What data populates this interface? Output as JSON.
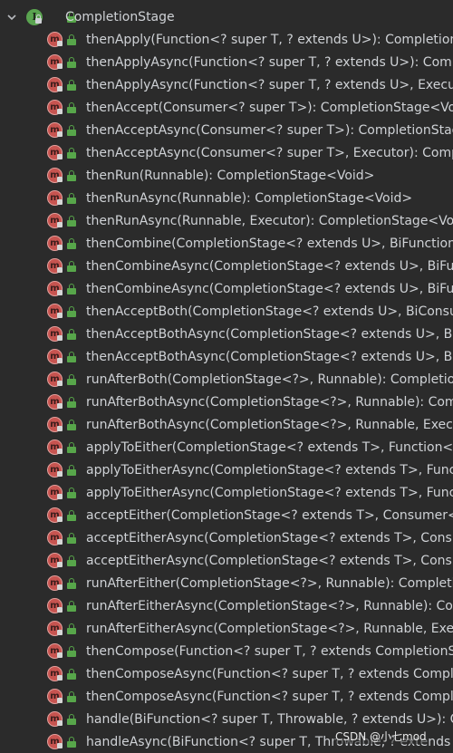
{
  "tree": {
    "interface": {
      "name": "CompletionStage",
      "icon": "interface-icon",
      "expanded": true
    },
    "methods": [
      "thenApply(Function<? super T, ? extends U>): CompletionStage<U>",
      "thenApplyAsync(Function<? super T, ? extends U>): CompletionStage<U>",
      "thenApplyAsync(Function<? super T, ? extends U>, Executor): CompletionStage<U>",
      "thenAccept(Consumer<? super T>): CompletionStage<Void>",
      "thenAcceptAsync(Consumer<? super T>): CompletionStage<Void>",
      "thenAcceptAsync(Consumer<? super T>, Executor): CompletionStage<Void>",
      "thenRun(Runnable): CompletionStage<Void>",
      "thenRunAsync(Runnable): CompletionStage<Void>",
      "thenRunAsync(Runnable, Executor): CompletionStage<Void>",
      "thenCombine(CompletionStage<? extends U>, BiFunction<? super T, ? super U, ? extends V>): CompletionStage<V>",
      "thenCombineAsync(CompletionStage<? extends U>, BiFunction<? super T, ? super U, ? extends V>): CompletionStage<V>",
      "thenCombineAsync(CompletionStage<? extends U>, BiFunction<? super T, ? super U, ? extends V>, Executor): CompletionStage<V>",
      "thenAcceptBoth(CompletionStage<? extends U>, BiConsumer<? super T, ? super U>): CompletionStage<Void>",
      "thenAcceptBothAsync(CompletionStage<? extends U>, BiConsumer<? super T, ? super U>): CompletionStage<Void>",
      "thenAcceptBothAsync(CompletionStage<? extends U>, BiConsumer<? super T, ? super U>, Executor): CompletionStage<Void>",
      "runAfterBoth(CompletionStage<?>, Runnable): CompletionStage<Void>",
      "runAfterBothAsync(CompletionStage<?>, Runnable): CompletionStage<Void>",
      "runAfterBothAsync(CompletionStage<?>, Runnable, Executor): CompletionStage<Void>",
      "applyToEither(CompletionStage<? extends T>, Function<? super T, U>): CompletionStage<U>",
      "applyToEitherAsync(CompletionStage<? extends T>, Function<? super T, U>): CompletionStage<U>",
      "applyToEitherAsync(CompletionStage<? extends T>, Function<? super T, U>, Executor): CompletionStage<U>",
      "acceptEither(CompletionStage<? extends T>, Consumer<? super T>): CompletionStage<Void>",
      "acceptEitherAsync(CompletionStage<? extends T>, Consumer<? super T>): CompletionStage<Void>",
      "acceptEitherAsync(CompletionStage<? extends T>, Consumer<? super T>, Executor): CompletionStage<Void>",
      "runAfterEither(CompletionStage<?>, Runnable): CompletionStage<Void>",
      "runAfterEitherAsync(CompletionStage<?>, Runnable): CompletionStage<Void>",
      "runAfterEitherAsync(CompletionStage<?>, Runnable, Executor): CompletionStage<Void>",
      "thenCompose(Function<? super T, ? extends CompletionStage<U>>): CompletionStage<U>",
      "thenComposeAsync(Function<? super T, ? extends CompletionStage<U>>): CompletionStage<U>",
      "thenComposeAsync(Function<? super T, ? extends CompletionStage<U>>, Executor): CompletionStage<U>",
      "handle(BiFunction<? super T, Throwable, ? extends U>): CompletionStage<U>",
      "handleAsync(BiFunction<? super T, Throwable, ? extends U>): CompletionStage<U>"
    ]
  },
  "watermark": "CSDN @小七mod",
  "colors": {
    "background": "#2b2b2b",
    "text": "#cfd2d6",
    "method_icon": "#c75450",
    "interface_icon": "#5aa450",
    "lock": "#57a64a"
  }
}
